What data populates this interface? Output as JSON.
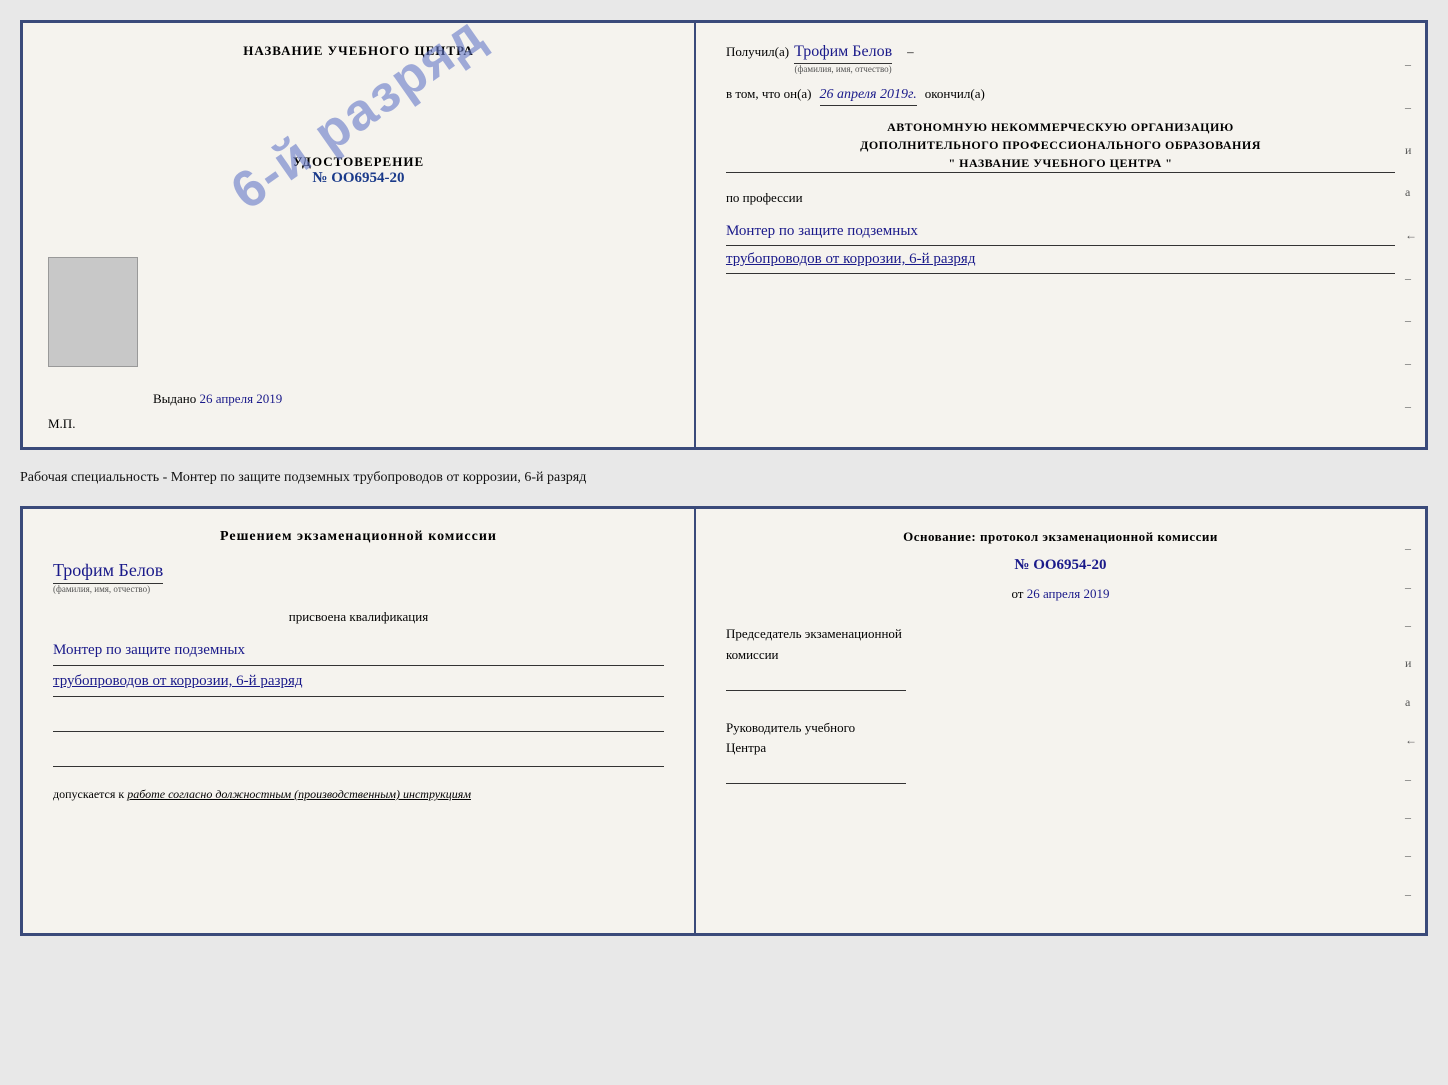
{
  "top_doc": {
    "left": {
      "center_title": "НАЗВАНИЕ УЧЕБНОГО ЦЕНТРА",
      "stamp_text": "6-й разряд",
      "udostoverenie_label": "УДОСТОВЕРЕНИЕ",
      "udost_num": "№ OO6954-20",
      "vydano_label": "Выдано",
      "vydano_date": "26 апреля 2019",
      "mp_label": "М.П."
    },
    "right": {
      "poluchil_label": "Получил(а)",
      "recipient_name": "Трофим Белов",
      "fio_sublabel": "(фамилия, имя, отчество)",
      "dash1": "–",
      "vtom_label": "в том, что он(а)",
      "completed_date": "26 апреля 2019г.",
      "okonchill_label": "окончил(а)",
      "org_line1": "АВТОНОМНУЮ НЕКОММЕРЧЕСКУЮ ОРГАНИЗАЦИЮ",
      "org_line2": "ДОПОЛНИТЕЛЬНОГО ПРОФЕССИОНАЛЬНОГО ОБРАЗОВАНИЯ",
      "org_name": "\" НАЗВАНИЕ УЧЕБНОГО ЦЕНТРА \"",
      "po_professii": "по профессии",
      "profession_line1": "Монтер по защите подземных",
      "profession_line2": "трубопроводов от коррозии, 6-й разряд"
    }
  },
  "middle": {
    "text": "Рабочая специальность - Монтер по защите подземных трубопроводов от коррозии, 6-й разряд"
  },
  "bottom_doc": {
    "left": {
      "resheniem_title": "Решением экзаменационной комиссии",
      "recipient_name": "Трофим Белов",
      "fio_sublabel": "(фамилия, имя, отчество)",
      "prisvoena": "присвоена квалификация",
      "qual_line1": "Монтер по защите подземных",
      "qual_line2": "трубопроводов от коррозии, 6-й разряд",
      "dopuskaetsya_prefix": "допускается к",
      "dopuskaetsya_text": "работе согласно должностным (производственным) инструкциям"
    },
    "right": {
      "osnovanie_title": "Основание: протокол экзаменационной комиссии",
      "protocol_num": "№ OO6954-20",
      "ot_label": "от",
      "ot_date": "26 апреля 2019",
      "predsedatel_line1": "Председатель экзаменационной",
      "predsedatel_line2": "комиссии",
      "rukovoditel_line1": "Руководитель учебного",
      "rukovoditel_line2": "Центра"
    }
  }
}
